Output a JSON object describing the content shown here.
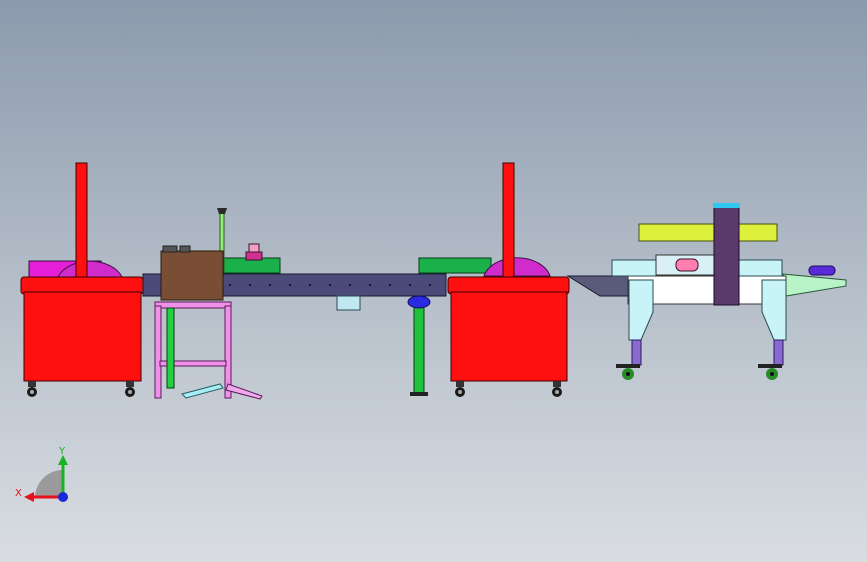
{
  "triad": {
    "x_label": "X",
    "y_label": "Y",
    "x_color": "#e8101a",
    "y_color": "#17b320",
    "z_color": "#1a28d8"
  },
  "colors": {
    "bg_top": "#8c9aad",
    "bg_bottom": "#d9dde2",
    "red": "#ff1010",
    "magenta": "#e020d0",
    "conveyor": "#4b4a78",
    "green": "#1bb14a",
    "brown": "#7a4e34",
    "pink": "#f090e8",
    "cyan": "#c8f4f8",
    "yellow": "#dcf03c",
    "purple": "#5a3a6a"
  }
}
